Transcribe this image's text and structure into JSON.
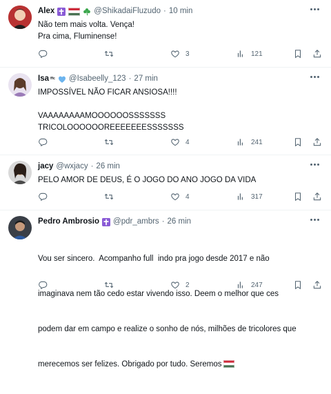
{
  "tweets": [
    {
      "name": "Alex",
      "handle": "@ShikadaiFluzudo",
      "separator": "·",
      "time": "10 min",
      "badges": [
        "cross-emoji",
        "hungary-flag-emoji",
        "shamrock-emoji"
      ],
      "lines": [
        "Não tem mais volta. Vença!",
        "Pra cima, Fluminense!"
      ],
      "reply_count": "",
      "retweet_count": "",
      "like_count": "3",
      "view_count": "121"
    },
    {
      "name": "Isa",
      "name_suffix": "ᶠᶠᶜ",
      "handle": "@Isabeelly_123",
      "separator": "·",
      "time": "27 min",
      "badges": [
        "blue-heart-emoji"
      ],
      "lines": [
        "IMPOSSÍVEL NÃO FICAR ANSIOSA!!!!",
        "",
        "VAAAAAAAAMOOOOOOSSSSSSS",
        "TRICOLOOOOOOREEEEEEESSSSSSS"
      ],
      "reply_count": "",
      "retweet_count": "",
      "like_count": "4",
      "view_count": "241"
    },
    {
      "name": "jacy",
      "handle": "@wxjacy",
      "separator": "·",
      "time": "26 min",
      "badges": [],
      "lines": [
        "PELO AMOR DE DEUS, É O JOGO DO ANO JOGO DA VIDA"
      ],
      "reply_count": "",
      "retweet_count": "",
      "like_count": "4",
      "view_count": "317"
    },
    {
      "name": "Pedro Ambrosio",
      "handle": "@pdr_ambrs",
      "separator": "·",
      "time": "26 min",
      "badges": [
        "cross-emoji"
      ],
      "lines": [
        "Vou ser sincero.  Acompanho full  indo pra jogo desde 2017 e não",
        "imaginava nem tão cedo estar vivendo isso. Deem o melhor que ces",
        "podem dar em campo e realize o sonho de nós, milhões de tricolores que",
        "merecemos ser felizes. Obrigado por tudo. Seremos"
      ],
      "trailing_emoji": "hungary-flag-emoji",
      "reply_count": "",
      "retweet_count": "",
      "like_count": "2",
      "view_count": "247"
    }
  ],
  "colors": {
    "text": "#0f1419",
    "secondary": "#536471",
    "divider": "#eff3f4",
    "cross_badge": "#8a5bd6",
    "heart": "#6cb4ee",
    "shamrock": "#3aa64c",
    "flag_red": "#ce2939",
    "flag_white": "#ffffff",
    "flag_green": "#477050"
  }
}
